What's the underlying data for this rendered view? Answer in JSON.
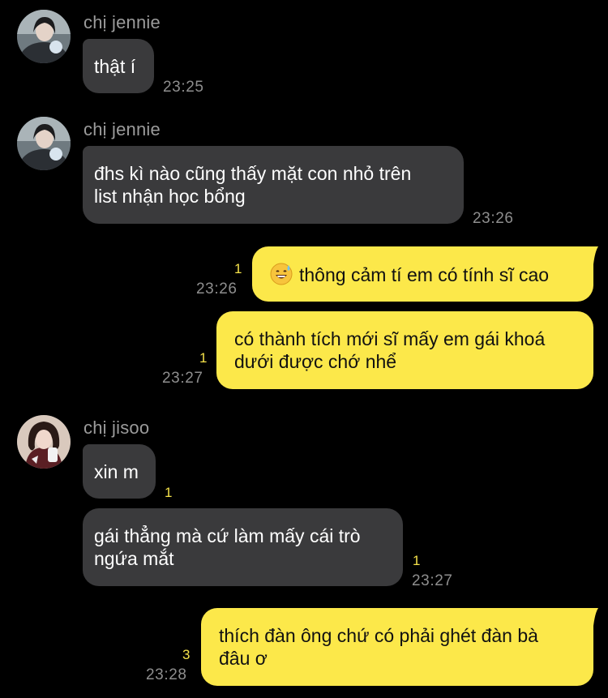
{
  "messages": {
    "m1": {
      "sender": "chị jennie",
      "text": "thật í",
      "time": "23:25"
    },
    "m2": {
      "sender": "chị jennie",
      "text_line1": "đhs kì nào cũng thấy mặt con nhỏ trên",
      "text_line2": "list nhận học bổng",
      "time": "23:26"
    },
    "m3": {
      "text": "thông cảm tí em có tính sĩ cao",
      "emoji": "sweat-smile-emoji",
      "unread": "1",
      "time": "23:26"
    },
    "m4": {
      "text_line1": "có thành tích mới sĩ mấy em gái khoá",
      "text_line2": "dưới được chớ nhể",
      "unread": "1",
      "time": "23:27"
    },
    "m5": {
      "sender": "chị jisoo",
      "text": "xin m",
      "unread": "1"
    },
    "m6": {
      "text_line1": "gái thẳng mà cứ làm mấy cái trò",
      "text_line2": "ngứa mắt",
      "unread": "1",
      "time": "23:27"
    },
    "m7": {
      "text_line1": "thích đàn ông chứ có phải ghét đàn bà",
      "text_line2": "đâu ơ",
      "unread": "3",
      "time": "23:28"
    }
  },
  "colors": {
    "background": "#000000",
    "incoming_bubble": "#3a3a3c",
    "outgoing_bubble": "#fce84a",
    "unread": "#f4e14a",
    "meta": "#8e8e8e"
  }
}
